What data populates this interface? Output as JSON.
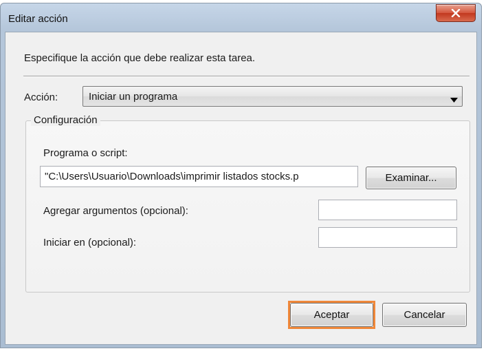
{
  "window": {
    "title": "Editar acción",
    "close_icon": "close-x-icon"
  },
  "dialog": {
    "instruction": "Especifique la acción que debe realizar esta tarea.",
    "action_label": "Acción:",
    "action_value": "Iniciar un programa",
    "dropdown_icon": "chevron-down-icon"
  },
  "config": {
    "legend": "Configuración",
    "program_label": "Programa o script:",
    "program_value": "\"C:\\Users\\Usuario\\Downloads\\imprimir listados stocks.p",
    "browse_label": "Examinar...",
    "args_label": "Agregar argumentos (opcional):",
    "args_value": "",
    "start_label": "Iniciar en (opcional):",
    "start_value": ""
  },
  "footer": {
    "ok_label": "Aceptar",
    "cancel_label": "Cancelar",
    "highlight_color": "#f0883a"
  }
}
